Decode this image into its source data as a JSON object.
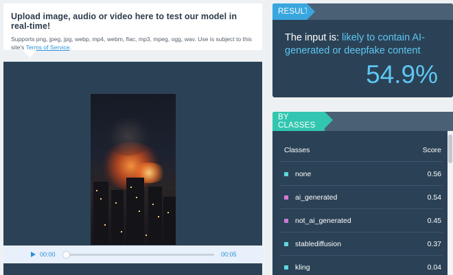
{
  "upload": {
    "title": "Upload image, audio or video here to test our model in real-time!",
    "subtitle_prefix": "Supports png, jpeg, jpg, webp, mp4, webm, flac, mp3, mpeg, ogg, wav. Use is subject to this site's ",
    "terms_link": "Terms of Service",
    "subtitle_suffix": "."
  },
  "video": {
    "current_time": "00:00",
    "end_time": "00:05",
    "progress": 0
  },
  "result": {
    "tag": "RESULT",
    "prefix": "The input is: ",
    "verdict": "likely to contain AI-generated or deepfake content",
    "score": "54.9%"
  },
  "classes": {
    "tag": "BY CLASSES",
    "header_classes": "Classes",
    "header_score": "Score",
    "rows": [
      {
        "name": "none",
        "score": "0.56",
        "color": "#5fd6d8"
      },
      {
        "name": "ai_generated",
        "score": "0.54",
        "color": "#d879d3"
      },
      {
        "name": "not_ai_generated",
        "score": "0.45",
        "color": "#c97bd8"
      },
      {
        "name": "stablediffusion",
        "score": "0.37",
        "color": "#62d6df"
      },
      {
        "name": "kling",
        "score": "0.04",
        "color": "#5fd6e3"
      }
    ]
  },
  "colors": {
    "accent_blue": "#3aa6de",
    "accent_teal": "#32c6b0",
    "panel_bg": "#2b4256"
  }
}
